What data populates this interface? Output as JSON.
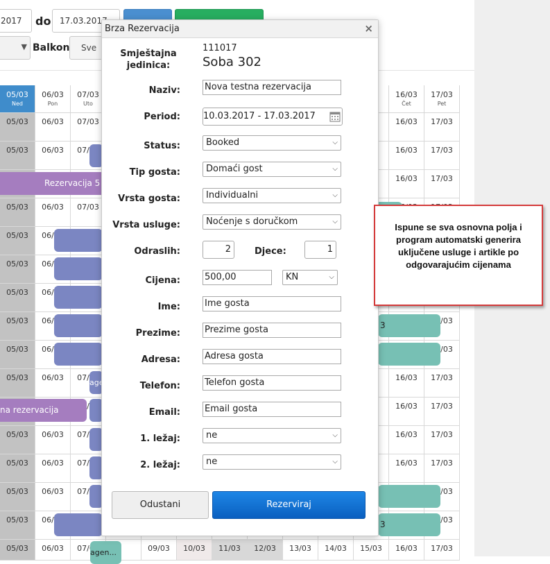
{
  "filter": {
    "date_from": "2017",
    "do_label": "do",
    "date_to": "17.03.2017",
    "balkon_label": "Balkon",
    "sve_label": "Sve"
  },
  "calendar": {
    "header": [
      {
        "date": "05/03",
        "day": "Ned"
      },
      {
        "date": "06/03",
        "day": "Pon"
      },
      {
        "date": "07/03",
        "day": "Uto"
      },
      {
        "date": "",
        "day": ""
      },
      {
        "date": "",
        "day": ""
      },
      {
        "date": "",
        "day": ""
      },
      {
        "date": "",
        "day": ""
      },
      {
        "date": "",
        "day": ""
      },
      {
        "date": "",
        "day": ""
      },
      {
        "date": "",
        "day": ""
      },
      {
        "date": "",
        "day": ""
      },
      {
        "date": "16/03",
        "day": "Čet"
      },
      {
        "date": "17/03",
        "day": "Pet"
      }
    ],
    "bottom_row": [
      "05/03",
      "06/03",
      "07/03",
      "",
      "09/03",
      "10/03",
      "11/03",
      "12/03",
      "13/03",
      "14/03",
      "15/03",
      "16/03",
      "17/03"
    ],
    "bars": {
      "rez5": "Rezervacija 5",
      "testna": "na rezervacija",
      "agen1": "agen",
      "agen2": "agen...",
      "three_a": "3",
      "three_b": "3"
    }
  },
  "modal": {
    "title": "Brza Rezervacija",
    "close": "×",
    "unit_label": "Smještajna jedinica:",
    "unit_code": "111017",
    "unit_name": "Soba 302",
    "fields": {
      "naziv_label": "Naziv:",
      "naziv": "Nova testna rezervacija",
      "period_label": "Period:",
      "period": "10.03.2017 - 17.03.2017",
      "status_label": "Status:",
      "status": "Booked",
      "tip_label": "Tip gosta:",
      "tip": "Domaći gost",
      "vrsta_gosta_label": "Vrsta gosta:",
      "vrsta_gosta": "Individualni",
      "vrsta_usluge_label": "Vrsta usluge:",
      "vrsta_usluge": "Noćenje s doručkom",
      "odrasli_label": "Odraslih:",
      "odrasli": "2",
      "djece_label": "Djece:",
      "djece": "1",
      "cijena_label": "Cijena:",
      "cijena": "500,00",
      "valuta": "KN",
      "ime_label": "Ime:",
      "ime": "Ime gosta",
      "prezime_label": "Prezime:",
      "prezime": "Prezime gosta",
      "adresa_label": "Adresa:",
      "adresa": "Adresa gosta",
      "telefon_label": "Telefon:",
      "telefon": "Telefon gosta",
      "email_label": "Email:",
      "email": "Email gosta",
      "lezaj1_label": "1. ležaj:",
      "lezaj1": "ne",
      "lezaj2_label": "2. ležaj:",
      "lezaj2": "ne"
    },
    "cancel_label": "Odustani",
    "submit_label": "Rezerviraj"
  },
  "callout": {
    "text": "Ispune se sva osnovna polja i program automatski generira uključene usluge i artikle po odgovarajućim cijenama"
  },
  "colors": {
    "header_active": "#3f8ccb",
    "bar_purple": "#a57dbf",
    "bar_blue": "#7b86c2",
    "bar_teal": "#77c0b4",
    "callout_border": "#d43a3a",
    "submit": "#0a5fc0"
  }
}
